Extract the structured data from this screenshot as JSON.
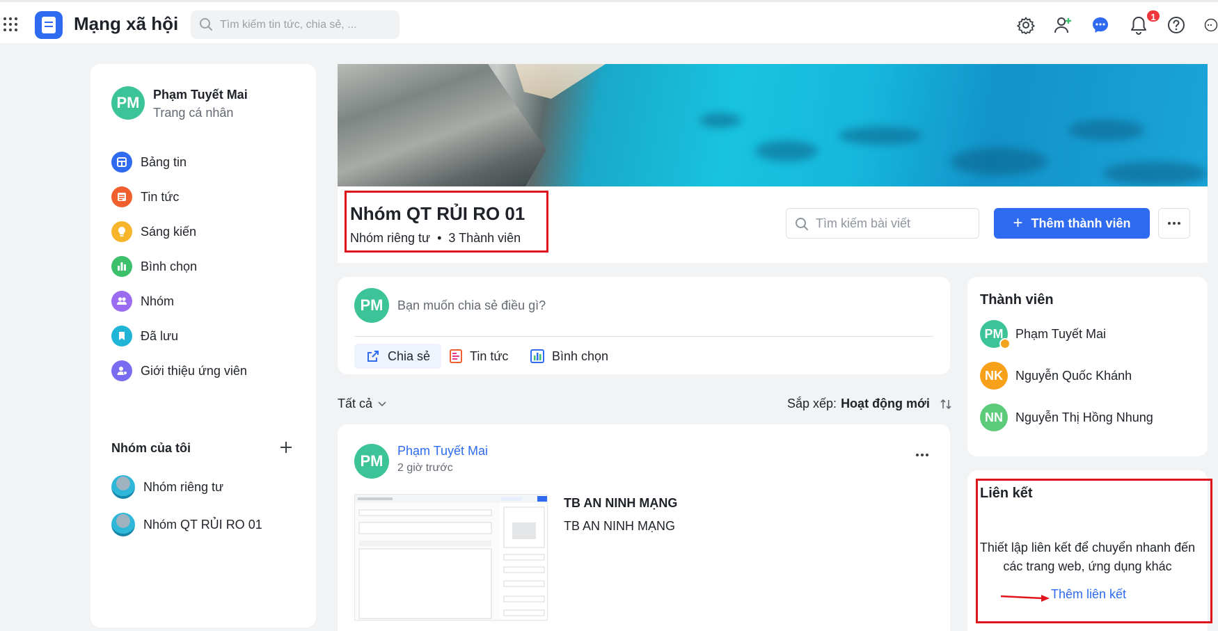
{
  "topbar": {
    "app_title": "Mạng xã hội",
    "search_placeholder": "Tìm kiếm tin tức, chia sẻ, ...",
    "notification_count": "1"
  },
  "sidebar": {
    "profile_initials": "PM",
    "profile_name": "Phạm Tuyết Mai",
    "profile_subtitle": "Trang cá nhân",
    "nav": [
      {
        "label": "Bảng tin",
        "icon": "newsfeed-icon",
        "color": "#2e6bf0"
      },
      {
        "label": "Tin tức",
        "icon": "news-icon",
        "color": "#f0602e"
      },
      {
        "label": "Sáng kiến",
        "icon": "lightbulb-icon",
        "color": "#f7b52b"
      },
      {
        "label": "Bình chọn",
        "icon": "poll-icon",
        "color": "#3cc06c"
      },
      {
        "label": "Nhóm",
        "icon": "group-icon",
        "color": "#9b6cf0"
      },
      {
        "label": "Đã lưu",
        "icon": "bookmark-icon",
        "color": "#20b4d6"
      },
      {
        "label": "Giới thiệu ứng viên",
        "icon": "referral-icon",
        "color": "#7a6cf0"
      }
    ],
    "my_groups_title": "Nhóm của tôi",
    "groups": [
      "Nhóm riêng tư",
      "Nhóm QT RỦI RO 01"
    ]
  },
  "group": {
    "name": "Nhóm QT RỦI RO 01",
    "privacy": "Nhóm riêng tư",
    "dot": "•",
    "member_count": "3 Thành viên",
    "search_placeholder": "Tìm kiếm bài viết",
    "add_member_label": "Thêm thành viên"
  },
  "composer": {
    "initials": "PM",
    "prompt": "Bạn muốn chia sẻ điều gì?",
    "actions": [
      "Chia sẻ",
      "Tin tức",
      "Bình chọn"
    ]
  },
  "feed": {
    "filter_label": "Tất cả",
    "sort_prefix": "Sắp xếp:",
    "sort_value": "Hoạt động mới"
  },
  "post": {
    "initials": "PM",
    "author": "Phạm Tuyết Mai",
    "time": "2 giờ trước",
    "title": "TB AN NINH MẠNG",
    "body": "TB AN NINH MẠNG"
  },
  "members": {
    "title": "Thành viên",
    "list": [
      {
        "initials": "PM",
        "name": "Phạm Tuyết Mai",
        "color": "#3cc398"
      },
      {
        "initials": "NK",
        "name": "Nguyễn Quốc Khánh",
        "color": "#f7a11a"
      },
      {
        "initials": "NN",
        "name": "Nguyễn Thị Hồng Nhung",
        "color": "#5ccc7a"
      }
    ]
  },
  "links": {
    "title": "Liên kết",
    "description": "Thiết lập liên kết để chuyển nhanh đến các trang web, ứng dụng khác",
    "add_label": "Thêm liên kết"
  },
  "colors": {
    "primary": "#2e6bf0",
    "annotation_red": "#e0141b"
  }
}
